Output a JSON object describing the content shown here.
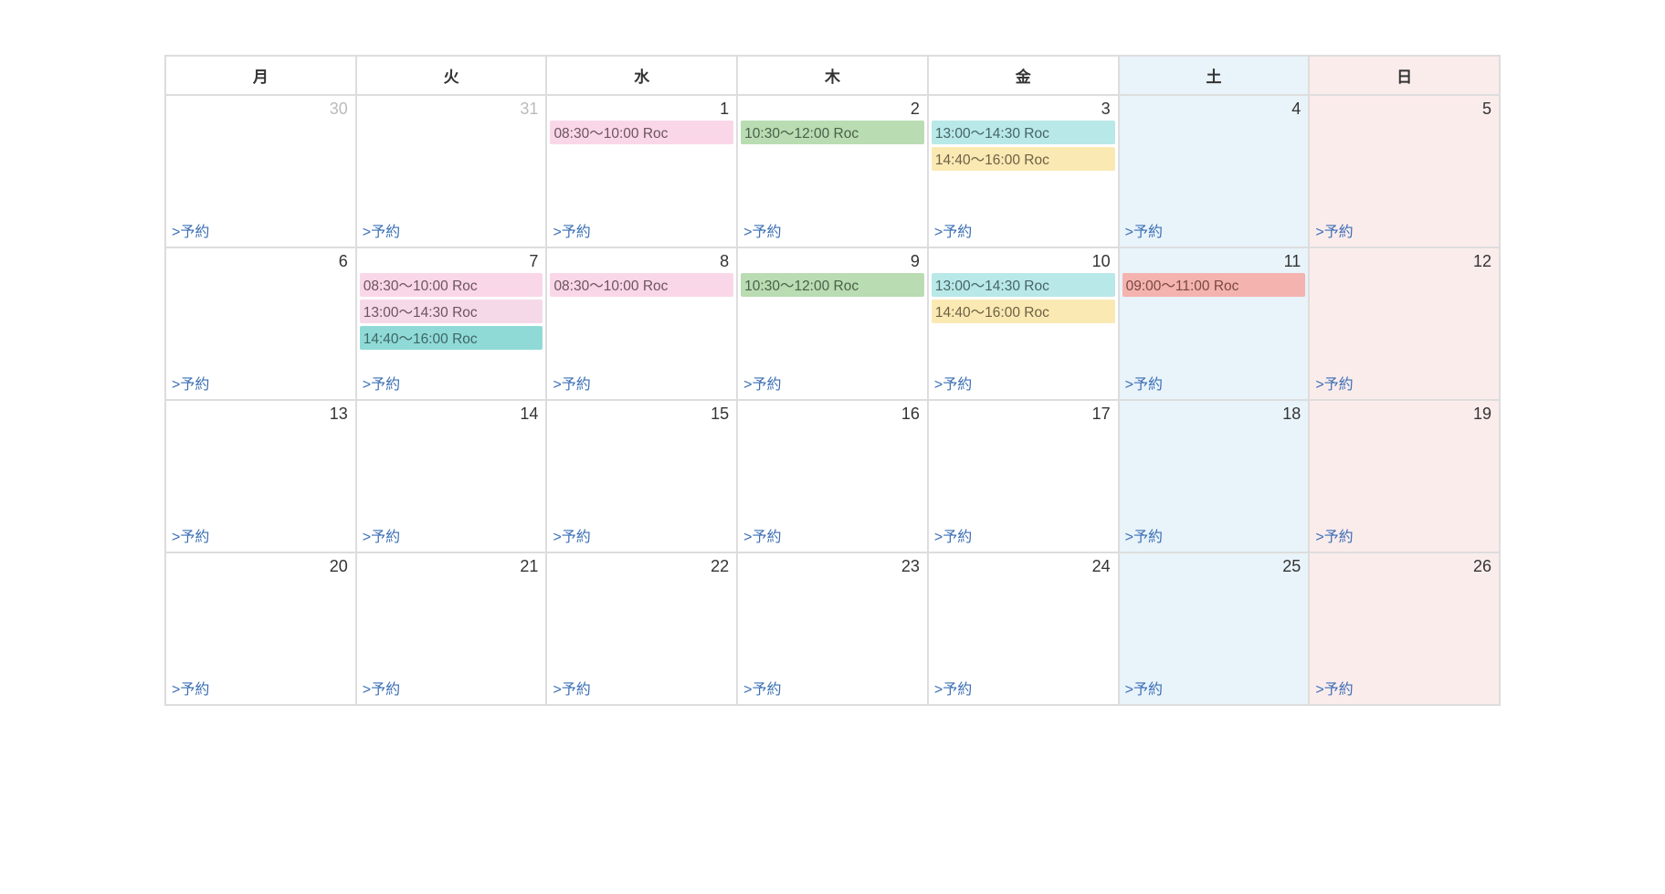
{
  "headers": [
    "月",
    "火",
    "水",
    "木",
    "金",
    "土",
    "日"
  ],
  "reserve_label": ">予約",
  "weeks": [
    [
      {
        "num": "30",
        "other": true,
        "cls": "",
        "events": []
      },
      {
        "num": "31",
        "other": true,
        "cls": "",
        "events": []
      },
      {
        "num": "1",
        "cls": "",
        "events": [
          {
            "t": "08:30～10:00 Roc",
            "c": "pink"
          }
        ]
      },
      {
        "num": "2",
        "cls": "",
        "events": [
          {
            "t": "10:30～12:00 Roc",
            "c": "green"
          }
        ]
      },
      {
        "num": "3",
        "cls": "",
        "events": [
          {
            "t": "13:00～14:30 Roc",
            "c": "cyan"
          },
          {
            "t": "14:40～16:00 Roc",
            "c": "yellow"
          }
        ]
      },
      {
        "num": "4",
        "cls": "sat",
        "events": []
      },
      {
        "num": "5",
        "cls": "sun",
        "events": []
      }
    ],
    [
      {
        "num": "6",
        "cls": "",
        "events": []
      },
      {
        "num": "7",
        "cls": "",
        "events": [
          {
            "t": "08:30～10:00 Roc",
            "c": "pink"
          },
          {
            "t": "13:00～14:30 Roc",
            "c": "mauve"
          },
          {
            "t": "14:40～16:00 Roc",
            "c": "teal"
          }
        ]
      },
      {
        "num": "8",
        "cls": "",
        "events": [
          {
            "t": "08:30～10:00 Roc",
            "c": "pink"
          }
        ]
      },
      {
        "num": "9",
        "cls": "",
        "events": [
          {
            "t": "10:30～12:00 Roc",
            "c": "green"
          }
        ]
      },
      {
        "num": "10",
        "cls": "",
        "events": [
          {
            "t": "13:00～14:30 Roc",
            "c": "cyan"
          },
          {
            "t": "14:40～16:00 Roc",
            "c": "yellow"
          }
        ]
      },
      {
        "num": "11",
        "cls": "sat",
        "events": [
          {
            "t": "09:00～11:00 Roc",
            "c": "red"
          }
        ]
      },
      {
        "num": "12",
        "cls": "sun",
        "events": []
      }
    ],
    [
      {
        "num": "13",
        "cls": "",
        "events": []
      },
      {
        "num": "14",
        "cls": "",
        "events": []
      },
      {
        "num": "15",
        "cls": "",
        "events": []
      },
      {
        "num": "16",
        "cls": "",
        "events": []
      },
      {
        "num": "17",
        "cls": "",
        "events": []
      },
      {
        "num": "18",
        "cls": "sat",
        "events": []
      },
      {
        "num": "19",
        "cls": "sun",
        "events": []
      }
    ],
    [
      {
        "num": "20",
        "cls": "",
        "events": []
      },
      {
        "num": "21",
        "cls": "",
        "events": []
      },
      {
        "num": "22",
        "cls": "",
        "events": []
      },
      {
        "num": "23",
        "cls": "",
        "events": []
      },
      {
        "num": "24",
        "cls": "",
        "events": []
      },
      {
        "num": "25",
        "cls": "sat",
        "events": []
      },
      {
        "num": "26",
        "cls": "sun",
        "events": []
      }
    ]
  ]
}
